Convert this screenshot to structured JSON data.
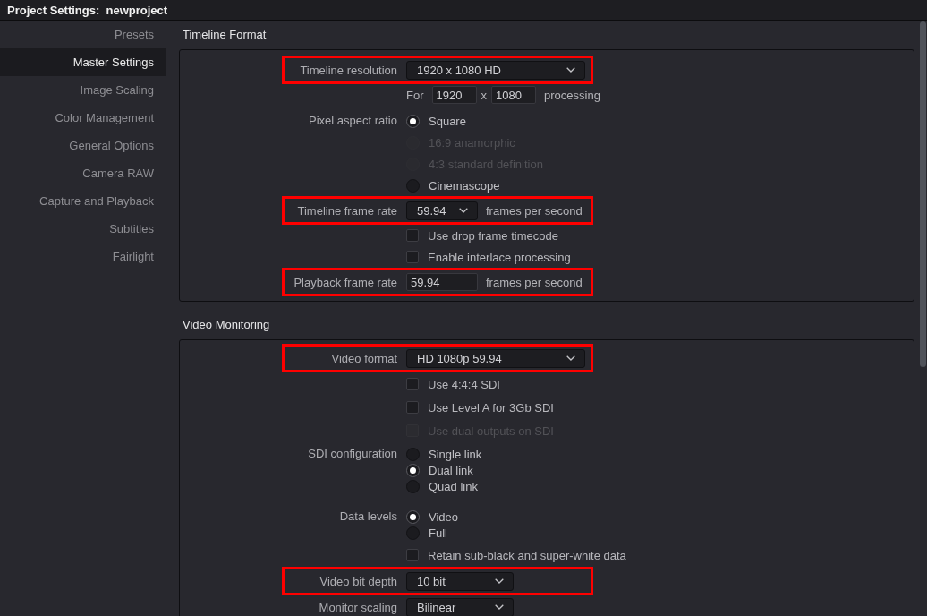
{
  "window": {
    "title": "Project Settings:  newproject"
  },
  "sidebar": {
    "items": [
      {
        "label": "Presets",
        "selected": false
      },
      {
        "label": "Master Settings",
        "selected": true
      },
      {
        "label": "Image Scaling",
        "selected": false
      },
      {
        "label": "Color Management",
        "selected": false
      },
      {
        "label": "General Options",
        "selected": false
      },
      {
        "label": "Camera RAW",
        "selected": false
      },
      {
        "label": "Capture and Playback",
        "selected": false
      },
      {
        "label": "Subtitles",
        "selected": false
      },
      {
        "label": "Fairlight",
        "selected": false
      }
    ]
  },
  "sections": [
    {
      "title": "Timeline Format",
      "rows": [
        {
          "kind": "dropdown",
          "label": "Timeline resolution",
          "value": "1920 x 1080 HD",
          "highlighted": true
        },
        {
          "kind": "dimensions",
          "prefix": "For",
          "values": [
            "1920",
            "1080"
          ],
          "separator": "x",
          "suffix": "processing",
          "highlighted": false
        },
        {
          "kind": "radio",
          "label": "Pixel aspect ratio",
          "highlighted": false,
          "options": [
            {
              "label": "Square",
              "selected": true,
              "disabled": false
            },
            {
              "label": "16:9 anamorphic",
              "selected": false,
              "disabled": true
            },
            {
              "label": "4:3 standard definition",
              "selected": false,
              "disabled": true
            },
            {
              "label": "Cinemascope",
              "selected": false,
              "disabled": false
            }
          ]
        },
        {
          "kind": "dropdown",
          "label": "Timeline frame rate",
          "value": "59.94",
          "suffix": "frames per second",
          "highlighted": true
        },
        {
          "kind": "checkbox",
          "text": "Use drop frame timecode",
          "checked": false,
          "disabled": false,
          "highlighted": false
        },
        {
          "kind": "checkbox",
          "text": "Enable interlace processing",
          "checked": false,
          "disabled": false,
          "highlighted": false
        },
        {
          "kind": "input",
          "label": "Playback frame rate",
          "value": "59.94",
          "suffix": "frames per second",
          "highlighted": true
        }
      ]
    },
    {
      "title": "Video Monitoring",
      "rows": [
        {
          "kind": "dropdown",
          "label": "Video format",
          "value": "HD 1080p 59.94",
          "highlighted": true
        },
        {
          "kind": "checkbox",
          "text": "Use 4:4:4 SDI",
          "checked": false,
          "disabled": false,
          "highlighted": false
        },
        {
          "kind": "checkbox",
          "text": "Use Level A for 3Gb SDI",
          "checked": false,
          "disabled": false,
          "highlighted": false
        },
        {
          "kind": "checkbox",
          "text": "Use dual outputs on SDI",
          "checked": false,
          "disabled": true,
          "highlighted": false
        },
        {
          "kind": "radio",
          "label": "SDI configuration",
          "highlighted": false,
          "options": [
            {
              "label": "Single link",
              "selected": false,
              "disabled": false
            },
            {
              "label": "Dual link",
              "selected": true,
              "disabled": false
            },
            {
              "label": "Quad link",
              "selected": false,
              "disabled": false
            }
          ]
        },
        {
          "kind": "radio",
          "label": "Data levels",
          "highlighted": false,
          "options": [
            {
              "label": "Video",
              "selected": true,
              "disabled": false
            },
            {
              "label": "Full",
              "selected": false,
              "disabled": false
            }
          ]
        },
        {
          "kind": "checkbox",
          "text": "Retain sub-black and super-white data",
          "checked": false,
          "disabled": false,
          "highlighted": false
        },
        {
          "kind": "dropdown",
          "label": "Video bit depth",
          "value": "10 bit",
          "highlighted": true
        },
        {
          "kind": "dropdown",
          "label": "Monitor scaling",
          "value": "Bilinear",
          "highlighted": false
        }
      ]
    }
  ]
}
